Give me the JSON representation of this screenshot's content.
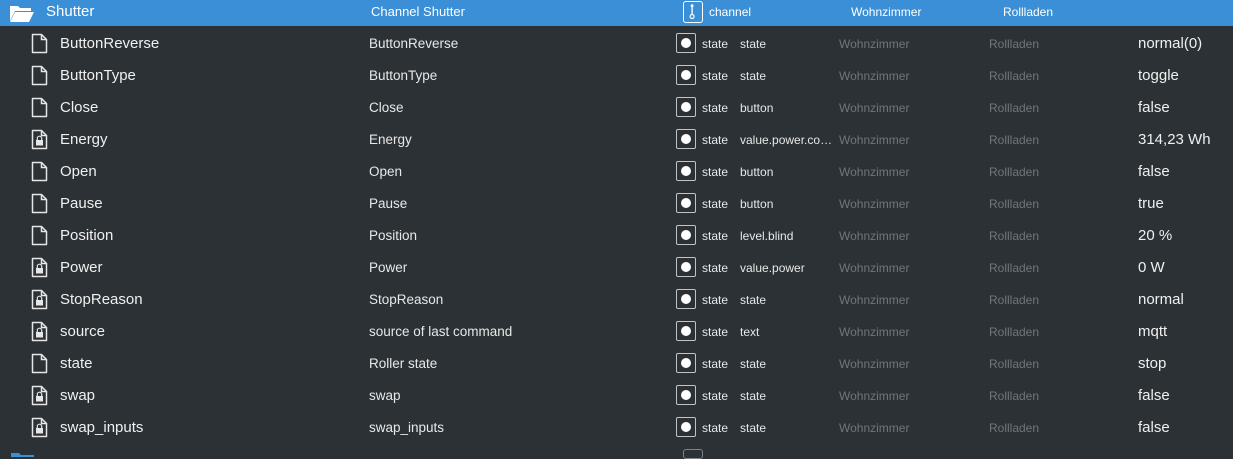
{
  "header": {
    "name": "Shutter",
    "title": "Channel Shutter",
    "type": "channel",
    "room": "Wohnzimmer",
    "function": "Rollladen",
    "icon": "folder-open-icon",
    "type_icon": "channel-icon",
    "color": "#3a8fd6"
  },
  "rows": [
    {
      "name": "ButtonReverse",
      "title": "ButtonReverse",
      "type": "state",
      "role": "state",
      "room": "Wohnzimmer",
      "function": "Rollladen",
      "value": "normal(0)",
      "icon": "file-icon"
    },
    {
      "name": "ButtonType",
      "title": "ButtonType",
      "type": "state",
      "role": "state",
      "room": "Wohnzimmer",
      "function": "Rollladen",
      "value": "toggle",
      "icon": "file-icon"
    },
    {
      "name": "Close",
      "title": "Close",
      "type": "state",
      "role": "button",
      "room": "Wohnzimmer",
      "function": "Rollladen",
      "value": "false",
      "icon": "file-icon"
    },
    {
      "name": "Energy",
      "title": "Energy",
      "type": "state",
      "role": "value.power.con...",
      "room": "Wohnzimmer",
      "function": "Rollladen",
      "value": "314,23 Wh",
      "icon": "file-lock-icon"
    },
    {
      "name": "Open",
      "title": "Open",
      "type": "state",
      "role": "button",
      "room": "Wohnzimmer",
      "function": "Rollladen",
      "value": "false",
      "icon": "file-icon"
    },
    {
      "name": "Pause",
      "title": "Pause",
      "type": "state",
      "role": "button",
      "room": "Wohnzimmer",
      "function": "Rollladen",
      "value": "true",
      "icon": "file-icon"
    },
    {
      "name": "Position",
      "title": "Position",
      "type": "state",
      "role": "level.blind",
      "room": "Wohnzimmer",
      "function": "Rollladen",
      "value": "20 %",
      "icon": "file-icon"
    },
    {
      "name": "Power",
      "title": "Power",
      "type": "state",
      "role": "value.power",
      "room": "Wohnzimmer",
      "function": "Rollladen",
      "value": "0 W",
      "icon": "file-lock-icon"
    },
    {
      "name": "StopReason",
      "title": "StopReason",
      "type": "state",
      "role": "state",
      "room": "Wohnzimmer",
      "function": "Rollladen",
      "value": "normal",
      "icon": "file-lock-icon"
    },
    {
      "name": "source",
      "title": "source of last command",
      "type": "state",
      "role": "text",
      "room": "Wohnzimmer",
      "function": "Rollladen",
      "value": "mqtt",
      "icon": "file-lock-icon"
    },
    {
      "name": "state",
      "title": "Roller state",
      "type": "state",
      "role": "state",
      "room": "Wohnzimmer",
      "function": "Rollladen",
      "value": "stop",
      "icon": "file-icon"
    },
    {
      "name": "swap",
      "title": "swap",
      "type": "state",
      "role": "state",
      "room": "Wohnzimmer",
      "function": "Rollladen",
      "value": "false",
      "icon": "file-lock-icon"
    },
    {
      "name": "swap_inputs",
      "title": "swap_inputs",
      "type": "state",
      "role": "state",
      "room": "Wohnzimmer",
      "function": "Rollladen",
      "value": "false",
      "icon": "file-lock-icon"
    }
  ]
}
